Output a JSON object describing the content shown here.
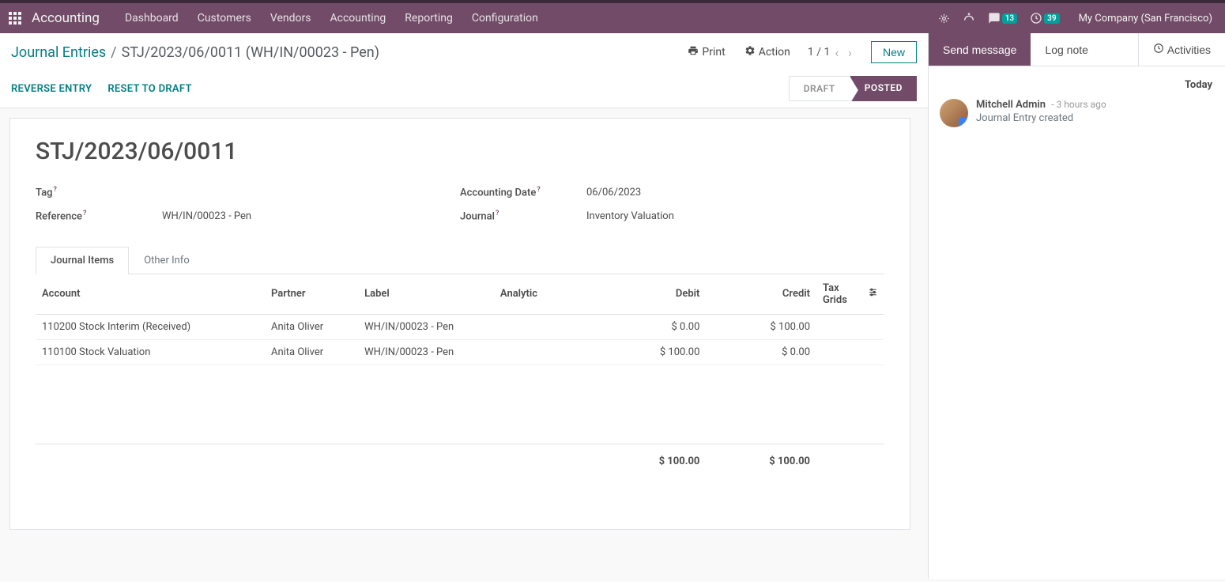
{
  "topbar": {
    "app_name": "Accounting",
    "nav": [
      "Dashboard",
      "Customers",
      "Vendors",
      "Accounting",
      "Reporting",
      "Configuration"
    ],
    "messages_badge": "13",
    "activities_badge": "39",
    "company": "My Company (San Francisco)"
  },
  "breadcrumb": {
    "root": "Journal Entries",
    "current": "STJ/2023/06/0011 (WH/IN/00023 - Pen)"
  },
  "actions": {
    "print": "Print",
    "action": "Action",
    "pager": "1 / 1",
    "new": "New",
    "reverse": "REVERSE ENTRY",
    "reset": "RESET TO DRAFT"
  },
  "status": {
    "draft": "DRAFT",
    "posted": "POSTED"
  },
  "form": {
    "title": "STJ/2023/06/0011",
    "labels": {
      "tag": "Tag",
      "reference": "Reference",
      "accounting_date": "Accounting Date",
      "journal": "Journal"
    },
    "values": {
      "tag": "",
      "reference": "WH/IN/00023 - Pen",
      "accounting_date": "06/06/2023",
      "journal": "Inventory Valuation"
    },
    "tabs": {
      "journal_items": "Journal Items",
      "other_info": "Other Info"
    }
  },
  "table": {
    "headers": {
      "account": "Account",
      "partner": "Partner",
      "label": "Label",
      "analytic": "Analytic",
      "debit": "Debit",
      "credit": "Credit",
      "tax_grids": "Tax Grids"
    },
    "rows": [
      {
        "account": "110200 Stock Interim (Received)",
        "partner": "Anita Oliver",
        "label": "WH/IN/00023 - Pen",
        "analytic": "",
        "debit": "$ 0.00",
        "credit": "$ 100.00",
        "tax_grids": ""
      },
      {
        "account": "110100 Stock Valuation",
        "partner": "Anita Oliver",
        "label": "WH/IN/00023 - Pen",
        "analytic": "",
        "debit": "$ 100.00",
        "credit": "$ 0.00",
        "tax_grids": ""
      }
    ],
    "totals": {
      "debit": "$ 100.00",
      "credit": "$ 100.00"
    }
  },
  "chatter": {
    "send_message": "Send message",
    "log_note": "Log note",
    "activities": "Activities",
    "today": "Today",
    "message": {
      "author": "Mitchell Admin",
      "time": "- 3 hours ago",
      "body": "Journal Entry created"
    }
  }
}
